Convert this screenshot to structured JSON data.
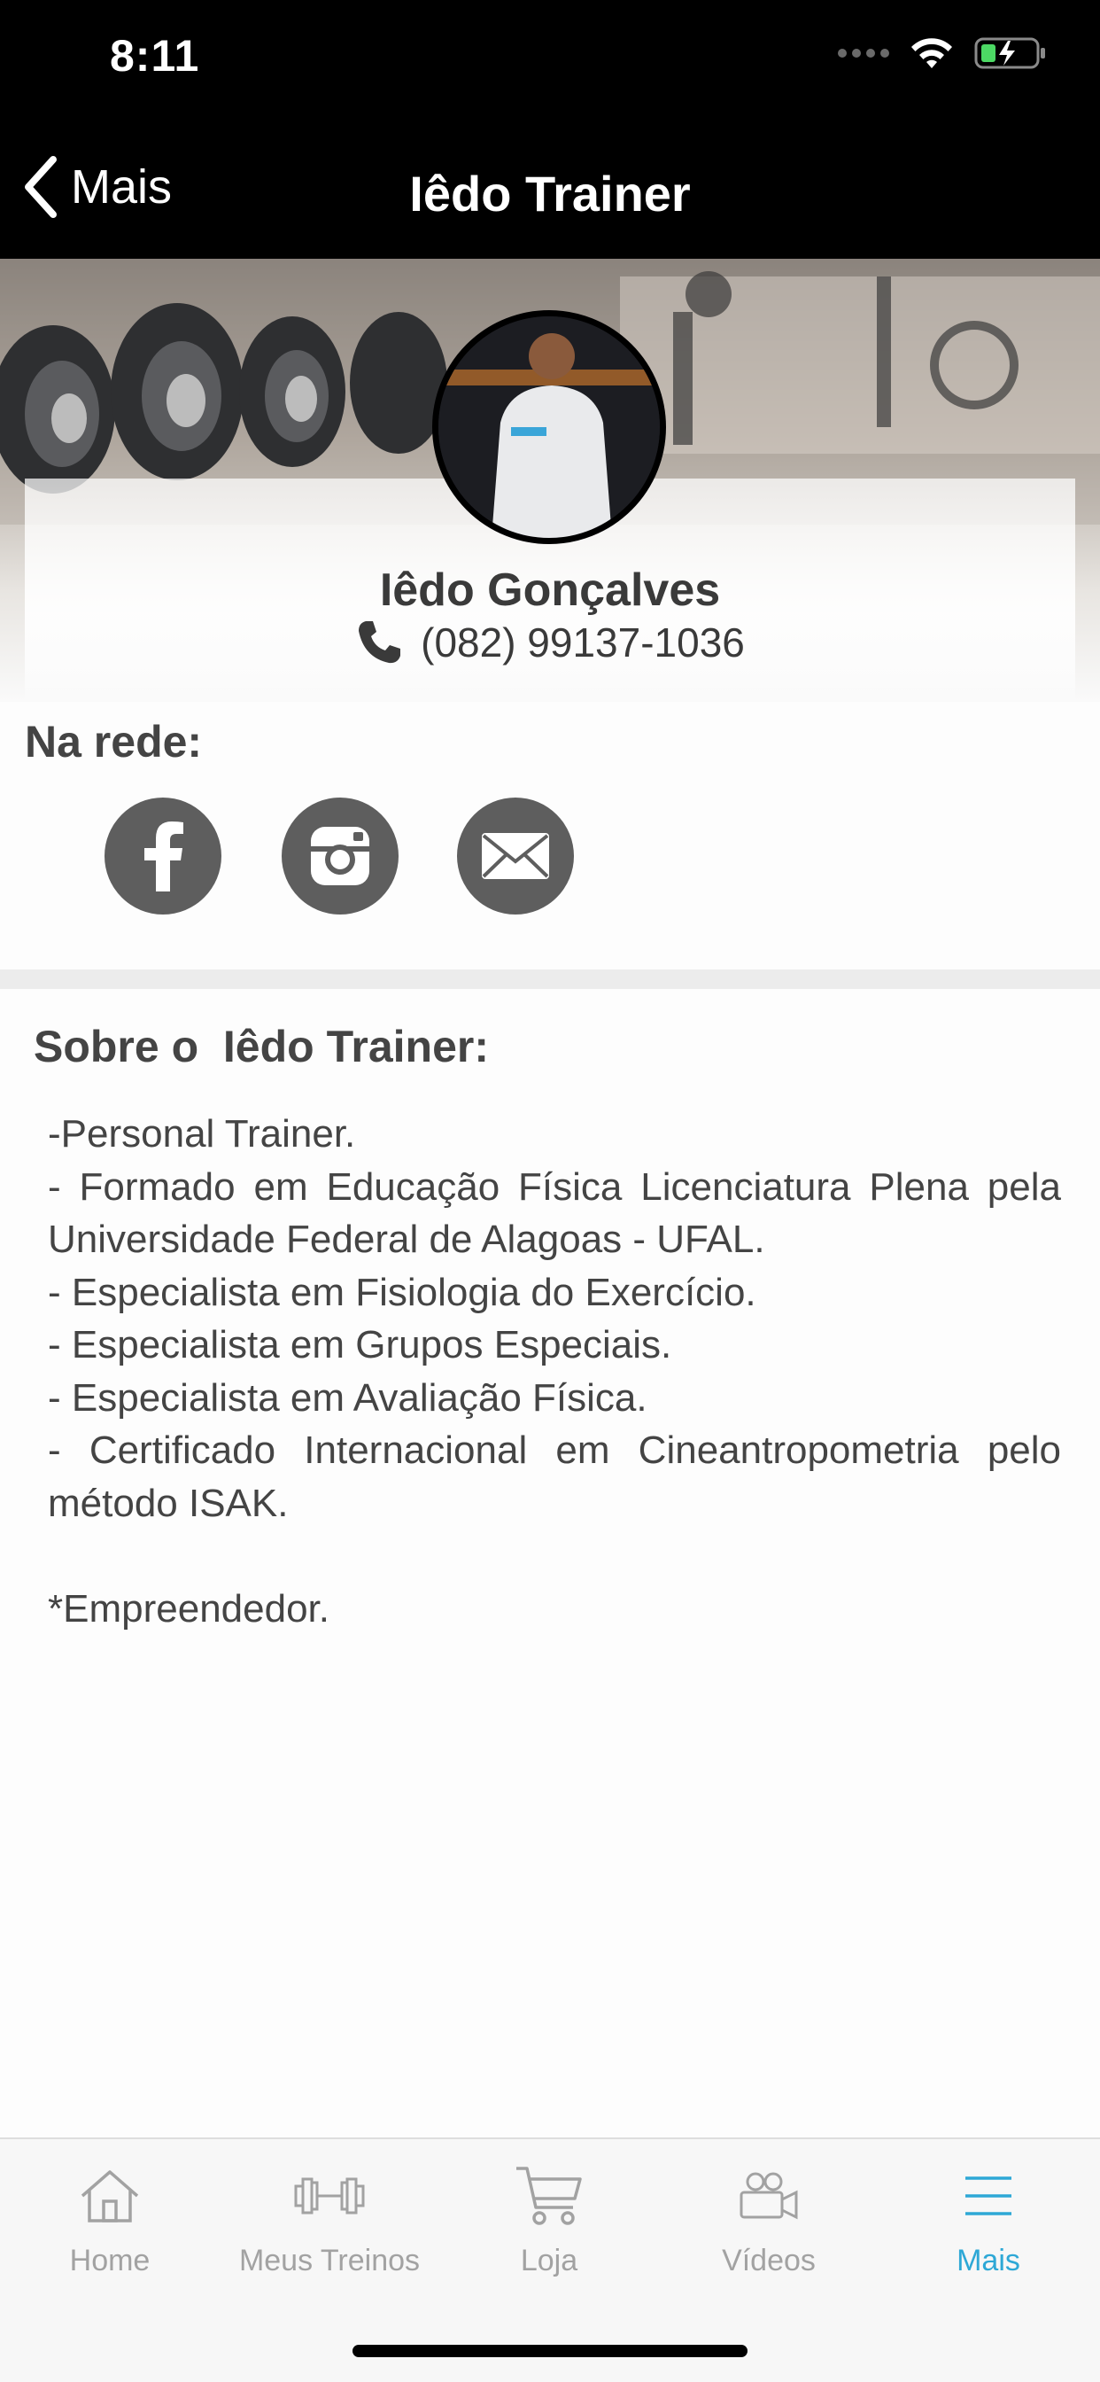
{
  "status_bar": {
    "time": "8:11"
  },
  "navbar": {
    "back_label": "Mais",
    "title": "Iêdo Trainer"
  },
  "profile": {
    "name": "Iêdo Gonçalves",
    "phone": "(082) 99137-1036"
  },
  "social": {
    "title": "Na rede:",
    "icons": [
      "facebook-icon",
      "instagram-icon",
      "email-icon"
    ]
  },
  "about": {
    "title": "Sobre o  Iêdo Trainer:",
    "lines": [
      "-Personal Trainer.",
      "- Formado em Educação Física Licenciatura Plena pela Universidade Federal de Alagoas - UFAL.",
      "- Especialista em Fisiologia do Exercício.",
      "- Especialista em Grupos Especiais.",
      "- Especialista em Avaliação Física.",
      "- Certificado Internacional em Cineantropometria pelo método ISAK.",
      "",
      "*Empreendedor."
    ]
  },
  "tabs": [
    {
      "label": "Home",
      "icon": "home-icon",
      "active": false
    },
    {
      "label": "Meus Treinos",
      "icon": "dumbbell-icon",
      "active": false
    },
    {
      "label": "Loja",
      "icon": "cart-icon",
      "active": false
    },
    {
      "label": "Vídeos",
      "icon": "video-camera-icon",
      "active": false
    },
    {
      "label": "Mais",
      "icon": "menu-icon",
      "active": true
    }
  ],
  "colors": {
    "accent": "#2ea8d6",
    "tab_inactive": "#a2a2a2",
    "social_bg": "#5e5e5e",
    "nav_bg": "#000000"
  }
}
